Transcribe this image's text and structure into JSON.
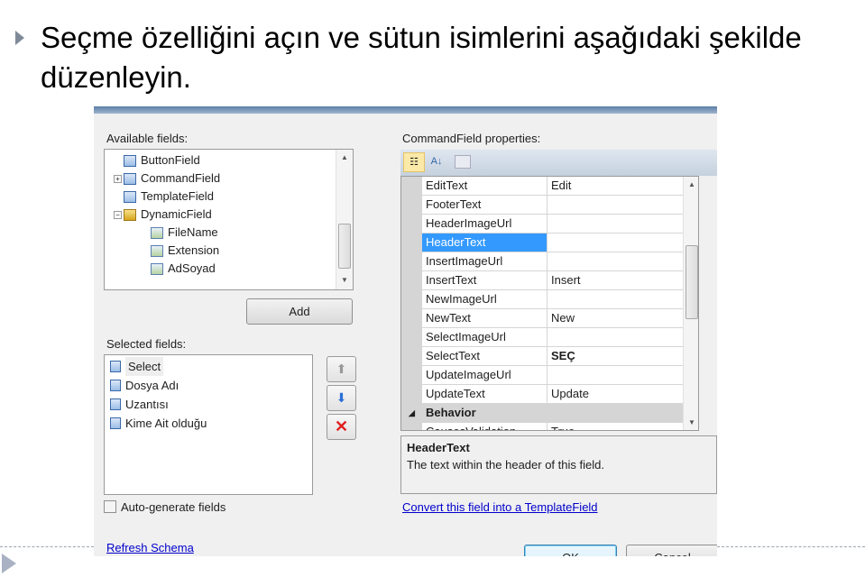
{
  "slide": {
    "title": "Seçme özelliğini açın ve sütun isimlerini aşağıdaki şekilde düzenleyin."
  },
  "dialog": {
    "available_label": "Available fields:",
    "available": [
      {
        "label": "ButtonField",
        "indent": 0,
        "expander": ""
      },
      {
        "label": "CommandField",
        "indent": 0,
        "expander": "+"
      },
      {
        "label": "TemplateField",
        "indent": 0,
        "expander": ""
      },
      {
        "label": "DynamicField",
        "indent": 0,
        "expander": "-"
      },
      {
        "label": "FileName",
        "indent": 1,
        "expander": ""
      },
      {
        "label": "Extension",
        "indent": 1,
        "expander": ""
      },
      {
        "label": "AdSoyad",
        "indent": 1,
        "expander": ""
      }
    ],
    "add_button": "Add",
    "selected_label": "Selected fields:",
    "selected": [
      "Select",
      "Dosya Adı",
      "Uzantısı",
      "Kime Ait olduğu"
    ],
    "auto_generate": "Auto-generate fields",
    "auto_generate_checked": false,
    "refresh_schema": "Refresh Schema",
    "properties_label": "CommandField properties:",
    "properties": [
      {
        "name": "EditText",
        "value": "Edit"
      },
      {
        "name": "FooterText",
        "value": ""
      },
      {
        "name": "HeaderImageUrl",
        "value": ""
      },
      {
        "name": "HeaderText",
        "value": "",
        "selected": true
      },
      {
        "name": "InsertImageUrl",
        "value": ""
      },
      {
        "name": "InsertText",
        "value": "Insert"
      },
      {
        "name": "NewImageUrl",
        "value": ""
      },
      {
        "name": "NewText",
        "value": "New"
      },
      {
        "name": "SelectImageUrl",
        "value": ""
      },
      {
        "name": "SelectText",
        "value": "SEÇ",
        "bold": true
      },
      {
        "name": "UpdateImageUrl",
        "value": ""
      },
      {
        "name": "UpdateText",
        "value": "Update"
      }
    ],
    "category": "Behavior",
    "next_property": {
      "name": "CausesValidation",
      "value": "True"
    },
    "desc_title": "HeaderText",
    "desc_text": "The text within the header of this field.",
    "convert_link": "Convert this field into a TemplateField",
    "ok_button": "OK",
    "cancel_button": "Cancel"
  }
}
